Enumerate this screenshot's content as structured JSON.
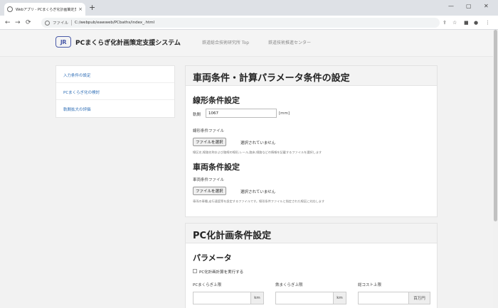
{
  "browser": {
    "tab_title": "Webアプリ - PCまくらぎ化計画策定支援システム",
    "tab_close": "×",
    "new_tab": "+",
    "url_scheme": "ファイル",
    "url": "C:/webpub/eawweb/PCbaths/index_.html",
    "window_minimize": "—",
    "window_maximize": "▢",
    "window_close": "✕",
    "nav_back": "←",
    "nav_forward": "→",
    "nav_reload": "⟳"
  },
  "header": {
    "logo": "JR",
    "brand": "PCまくらぎ化計画策定支援システム",
    "links": [
      "鉄道総合技術研究所 Top",
      "鉄道技術推進センター"
    ]
  },
  "sidebar": {
    "items": [
      "入力条件の設定",
      "PCまくらぎ化の検討",
      "軌間拡大の評価"
    ]
  },
  "vehicle_section": {
    "title": "車両条件・計算パラメータ条件の設定",
    "alignment": {
      "title": "線形条件設定",
      "gauge_label": "軌間",
      "gauge_value": "1067",
      "gauge_unit": "[mm]",
      "file_label": "線形条件ファイル",
      "file_button": "ファイルを選択",
      "file_status": "選択されていません",
      "help": "線区名,線路名称および路線の線形,レール,路床,線路などの情報を記載するファイルを選択します"
    },
    "vehicle": {
      "title": "車両条件設定",
      "file_label": "車両条件ファイル",
      "file_button": "ファイルを選択",
      "file_status": "選択されていません",
      "help": "車両の車種,走行速度等を設定するファイルです。線形条件ファイルと指定された線区に対応します"
    }
  },
  "pc_section": {
    "title": "PC化計画条件設定",
    "params_title": "パラメータ",
    "checkbox_label": "PC化計画計算を実行する",
    "fields": [
      {
        "label": "PCまくらぎ上限",
        "unit": "km"
      },
      {
        "label": "鉄まくらぎ上限",
        "unit": "km"
      },
      {
        "label": "総コスト上限",
        "unit": "百万円"
      }
    ]
  }
}
